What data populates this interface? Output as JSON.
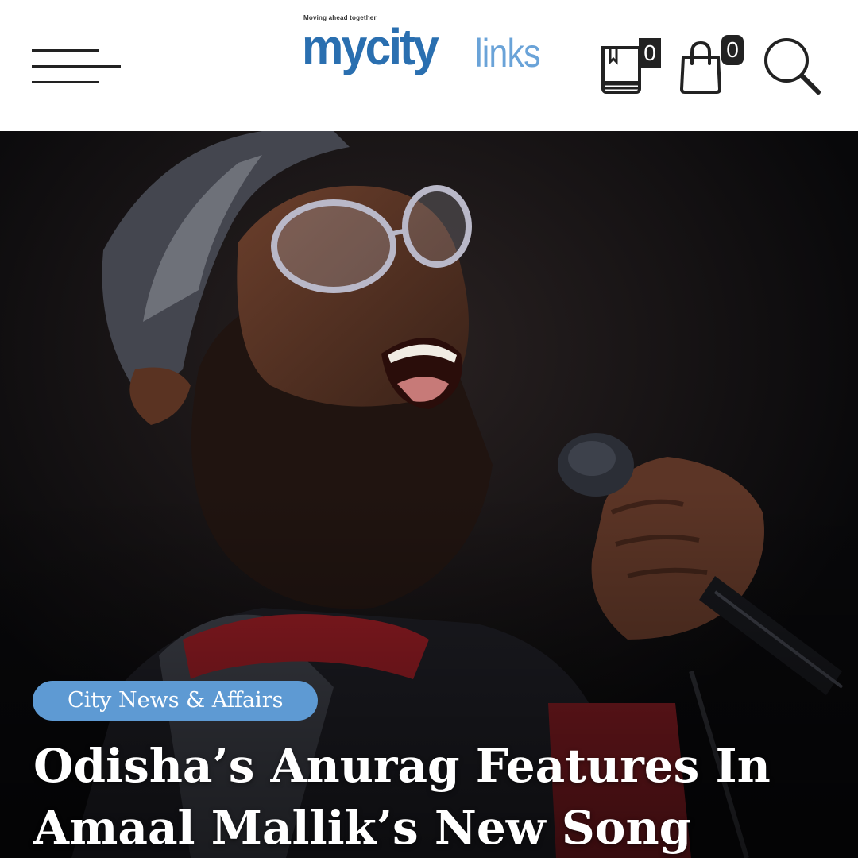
{
  "header": {
    "menu_icon": "hamburger-menu-icon",
    "logo": {
      "tagline": "Moving ahead together",
      "word_primary": "mycity",
      "word_secondary": "links",
      "primary_color": "#2a6fb0",
      "secondary_color": "#6aa3d8"
    },
    "library": {
      "icon": "book-icon",
      "count": "0"
    },
    "cart": {
      "icon": "shopping-bag-icon",
      "count": "0"
    },
    "search": {
      "icon": "search-icon"
    }
  },
  "hero": {
    "image_alt": "Singer performing with a microphone",
    "category": "City News & Affairs",
    "category_color": "#5e9ad3",
    "title": "Odisha’s Anurag Features In Amaal Mallik’s New Song"
  }
}
